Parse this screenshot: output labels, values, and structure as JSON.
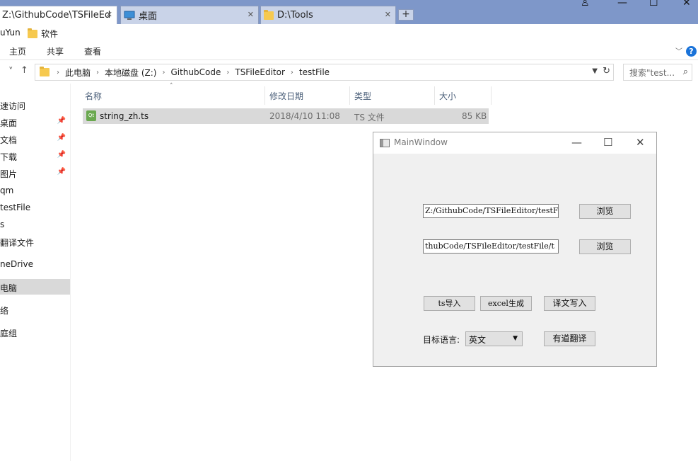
{
  "tabs": [
    {
      "label": "Z:\\GithubCode\\TSFileEditor\\testFile",
      "active": true
    },
    {
      "label": "桌面",
      "active": false
    },
    {
      "label": "D:\\Tools",
      "active": false
    }
  ],
  "favorites": [
    "uYun",
    "软件"
  ],
  "ribbon": {
    "tabs": [
      "主页",
      "共享",
      "查看"
    ]
  },
  "address": {
    "crumbs": [
      "此电脑",
      "本地磁盘 (Z:)",
      "GithubCode",
      "TSFileEditor",
      "testFile"
    ],
    "search_placeholder": "搜索\"test..."
  },
  "nav": {
    "items": [
      {
        "label": "速访问",
        "pinned": false
      },
      {
        "label": "桌面",
        "pinned": true
      },
      {
        "label": "文档",
        "pinned": true
      },
      {
        "label": "下载",
        "pinned": true
      },
      {
        "label": "图片",
        "pinned": true
      },
      {
        "label": "qm",
        "pinned": false
      },
      {
        "label": "testFile",
        "pinned": false
      },
      {
        "label": "s",
        "pinned": false
      },
      {
        "label": "翻译文件",
        "pinned": false
      },
      {
        "label": "neDrive",
        "pinned": false
      },
      {
        "label": "电脑",
        "pinned": false,
        "selected": true
      },
      {
        "label": "络",
        "pinned": false
      },
      {
        "label": "庭组",
        "pinned": false
      }
    ]
  },
  "list": {
    "columns": [
      "名称",
      "修改日期",
      "类型",
      "大小"
    ],
    "rows": [
      {
        "name": "string_zh.ts",
        "modified": "2018/4/10 11:08",
        "type": "TS 文件",
        "size": "85 KB"
      }
    ]
  },
  "qtwindow": {
    "title": "MainWindow",
    "input1": "Z:/GithubCode/TSFileEditor/testF",
    "input2": "thubCode/TSFileEditor/testFile/t",
    "browse_label": "浏览",
    "ts_import": "ts导入",
    "excel_generate": "excel生成",
    "write_translation": "译文写入",
    "target_lang_label": "目标语言:",
    "target_lang_value": "英文",
    "youdao_translate": "有道翻译"
  },
  "colors": {
    "tabbar": "#7e97c9",
    "selection": "#d9d9d9",
    "help": "#1a73d9"
  }
}
